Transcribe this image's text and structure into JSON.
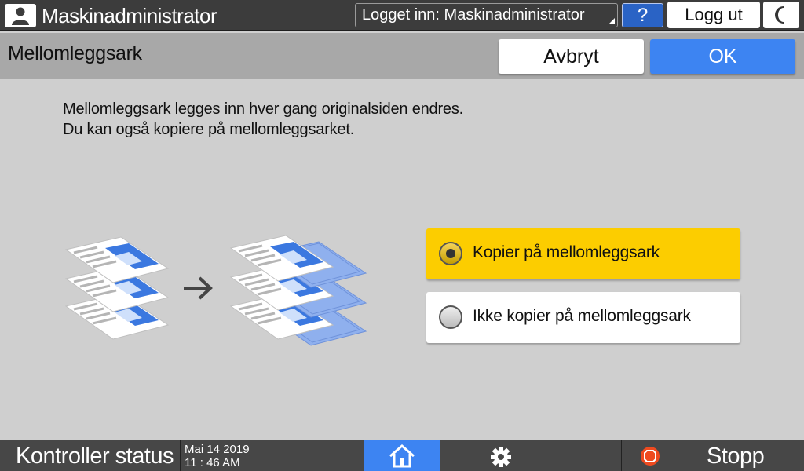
{
  "topbar": {
    "app_title": "Maskinadministrator",
    "login_status": "Logget inn: Maskinadministrator",
    "help_label": "?",
    "logout_label": "Logg ut",
    "icons": [
      "user-icon",
      "help-icon",
      "moon-icon"
    ]
  },
  "header": {
    "title": "Mellomleggsark",
    "cancel_label": "Avbryt",
    "ok_label": "OK"
  },
  "content": {
    "description_line1": "Mellomleggsark legges inn hver gang originalsiden endres.",
    "description_line2": "Du kan også kopiere på mellomleggsarket.",
    "options": [
      {
        "label": "Kopier på mellomleggsark",
        "selected": true
      },
      {
        "label": "Ikke kopier på mellomleggsark",
        "selected": false
      }
    ]
  },
  "bottombar": {
    "controller_status_label": "Kontroller status",
    "date": "Mai 14 2019",
    "time": "11 : 46 AM",
    "stop_label": "Stopp",
    "icons": [
      "home-icon",
      "gear-icon",
      "stop-icon"
    ]
  },
  "colors": {
    "accent_blue": "#3d84f2",
    "selected_yellow": "#fccd00",
    "topbar_dark": "#3c3c3c",
    "help_blue": "#2a63c5"
  }
}
